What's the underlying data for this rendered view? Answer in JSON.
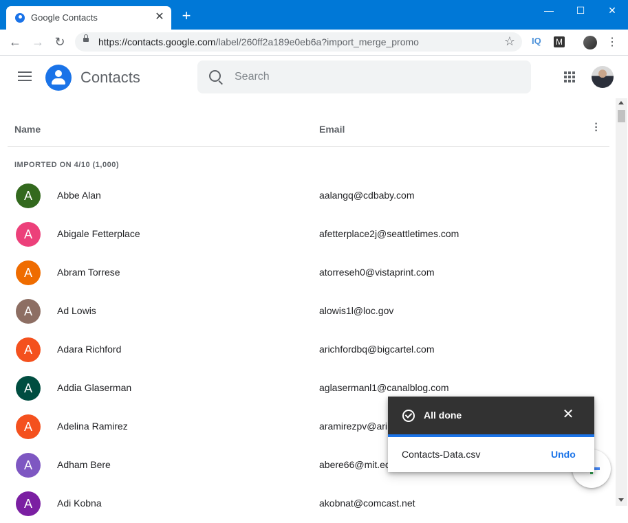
{
  "browser": {
    "tab_title": "Google Contacts",
    "tab_close": "✕",
    "new_tab": "+",
    "window_minimize": "—",
    "window_maximize": "☐",
    "window_close": "✕",
    "url_host": "https://contacts.google.com",
    "url_path": "/label/260ff2a189e0eb6a?import_merge_promo",
    "bookmark_star": "☆",
    "back": "←",
    "forward": "→",
    "reload": "↻",
    "ext_iq": "IQ",
    "ext_m": "M",
    "menu": "⋮"
  },
  "app": {
    "title": "Contacts",
    "search_placeholder": "Search"
  },
  "table": {
    "col_name": "Name",
    "col_email": "Email",
    "more": "⋮",
    "section_label": "IMPORTED ON 4/10 (1,000)",
    "rows": [
      {
        "initial": "A",
        "name": "Abbe Alan",
        "email": "aalangq@cdbaby.com",
        "color": "#33691e"
      },
      {
        "initial": "A",
        "name": "Abigale Fetterplace",
        "email": "afetterplace2j@seattletimes.com",
        "color": "#ec407a"
      },
      {
        "initial": "A",
        "name": "Abram Torrese",
        "email": "atorreseh0@vistaprint.com",
        "color": "#ef6c00"
      },
      {
        "initial": "A",
        "name": "Ad Lowis",
        "email": "alowis1l@loc.gov",
        "color": "#8d6e63"
      },
      {
        "initial": "A",
        "name": "Adara Richford",
        "email": "arichfordbq@bigcartel.com",
        "color": "#f4511e"
      },
      {
        "initial": "A",
        "name": "Addia Glaserman",
        "email": "aglasermanl1@canalblog.com",
        "color": "#004d40"
      },
      {
        "initial": "A",
        "name": "Adelina Ramirez",
        "email": "aramirezpv@ari",
        "color": "#f4511e"
      },
      {
        "initial": "A",
        "name": "Adham Bere",
        "email": "abere66@mit.ec",
        "color": "#7e57c2"
      },
      {
        "initial": "A",
        "name": "Adi Kobna",
        "email": "akobnat@comcast.net",
        "color": "#7b1fa2"
      }
    ]
  },
  "toast": {
    "title": "All done",
    "close": "✕",
    "file": "Contacts-Data.csv",
    "undo": "Undo"
  }
}
